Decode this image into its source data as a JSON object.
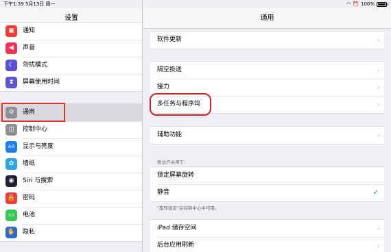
{
  "status_bar": {
    "time_date": "下午1:39  5月13日 周一",
    "battery_percent": "100%",
    "wifi_icon": "wifi-icon",
    "alarm_icon": "alarm-icon"
  },
  "sidebar": {
    "title": "设置",
    "group1": [
      {
        "label": "通知",
        "icon": "notifications-icon",
        "color": "#f33b30",
        "glyph": "▣"
      },
      {
        "label": "声音",
        "icon": "sound-icon",
        "color": "#f2325a",
        "glyph": "◀"
      },
      {
        "label": "勿扰模式",
        "icon": "moon-icon",
        "color": "#5a50d5",
        "glyph": "☾"
      },
      {
        "label": "屏幕使用时间",
        "icon": "hourglass-icon",
        "color": "#5b54d6",
        "glyph": "⧗"
      }
    ],
    "group2": [
      {
        "label": "通用",
        "icon": "gear-icon",
        "color": "#8e8e93",
        "glyph": "⚙",
        "selected": true
      },
      {
        "label": "控制中心",
        "icon": "control-center-icon",
        "color": "#8e8e93",
        "glyph": "◫"
      },
      {
        "label": "显示与亮度",
        "icon": "display-icon",
        "color": "#1a7ef5",
        "glyph": "AA"
      },
      {
        "label": "墙纸",
        "icon": "wallpaper-icon",
        "color": "#2fa4e6",
        "glyph": "✿"
      },
      {
        "label": "Siri 与搜索",
        "icon": "siri-icon",
        "color": "#222233",
        "glyph": "◉"
      },
      {
        "label": "密码",
        "icon": "lock-icon",
        "color": "#f23b3f",
        "glyph": "🔒"
      },
      {
        "label": "电池",
        "icon": "battery-icon",
        "color": "#38c759",
        "glyph": "▭"
      },
      {
        "label": "隐私",
        "icon": "hand-icon",
        "color": "#2c6ad8",
        "glyph": "✋"
      }
    ]
  },
  "detail": {
    "title": "通用",
    "group_software": [
      {
        "label": "软件更新"
      }
    ],
    "group_share": [
      {
        "label": "隔空投送"
      },
      {
        "label": "接力"
      },
      {
        "label": "多任务与程序坞"
      }
    ],
    "group_access": [
      {
        "label": "辅助功能"
      }
    ],
    "side_switch_header": "侧边开关用于:",
    "group_side_switch": [
      {
        "label": "锁定屏幕旋转",
        "checked": false
      },
      {
        "label": "静音",
        "checked": true
      }
    ],
    "side_switch_footer": "\"旋转锁定\"在控制中心中可用。",
    "group_storage": [
      {
        "label": "iPad 储存空间"
      },
      {
        "label": "后台应用刷新"
      }
    ],
    "chevron": "›",
    "checkmark": "✓"
  }
}
